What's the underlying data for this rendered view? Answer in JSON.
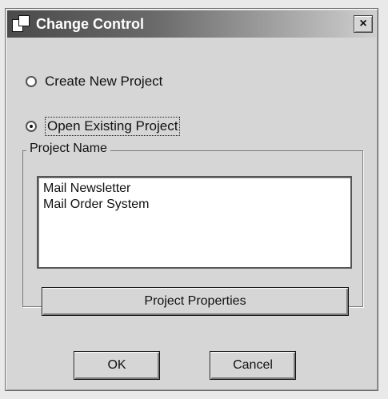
{
  "window": {
    "title": "Change Control",
    "close_glyph": "×"
  },
  "options": {
    "create_label": "Create New Project",
    "open_label": "Open Existing Project",
    "selected": "open"
  },
  "group": {
    "label": "Project Name",
    "projects": [
      "Mail Newsletter",
      "Mail Order System"
    ]
  },
  "buttons": {
    "properties": "Project Properties",
    "ok": "OK",
    "cancel": "Cancel"
  }
}
